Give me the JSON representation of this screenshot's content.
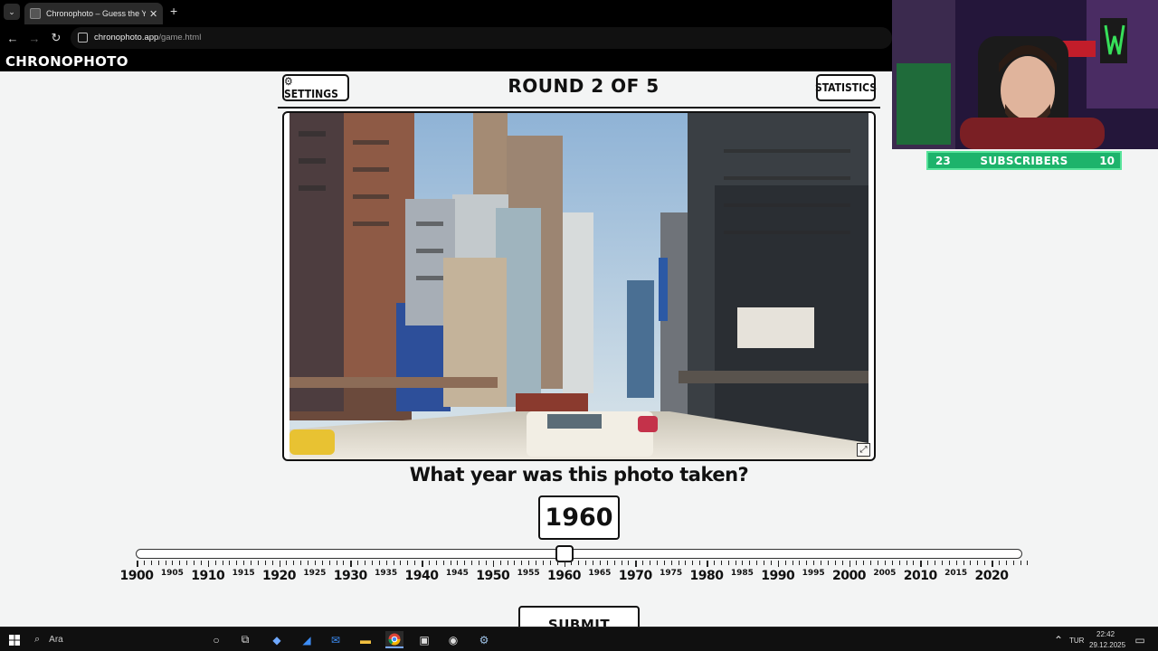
{
  "browser": {
    "tab_title": "Chronophoto – Guess the Year",
    "url_host": "chronophoto.app",
    "url_path": "/game.html"
  },
  "site": {
    "brand": "CHRONOPHOTO"
  },
  "game": {
    "settings_label": "⚙ SETTINGS",
    "statistics_label": "STATISTICS",
    "round_title": "ROUND 2 OF 5",
    "question": "What year was this photo taken?",
    "selected_year": "1960",
    "submit_label": "SUBMIT",
    "slider": {
      "min": 1900,
      "max": 2025,
      "value": 1960,
      "major_labels": [
        "1900",
        "1910",
        "1920",
        "1930",
        "1940",
        "1950",
        "1960",
        "1970",
        "1980",
        "1990",
        "2000",
        "2010",
        "2020"
      ],
      "minor_labels": [
        "1905",
        "1915",
        "1925",
        "1935",
        "1945",
        "1955",
        "1965",
        "1975",
        "1985",
        "1995",
        "2005",
        "2015"
      ]
    }
  },
  "overlay": {
    "subscribers_left": "23",
    "subscribers_label": "SUBSCRIBERS",
    "subscribers_right": "10"
  },
  "taskbar": {
    "search_placeholder": "Ara",
    "language": "TUR",
    "time": "22:42",
    "date": "29.12.2025"
  }
}
